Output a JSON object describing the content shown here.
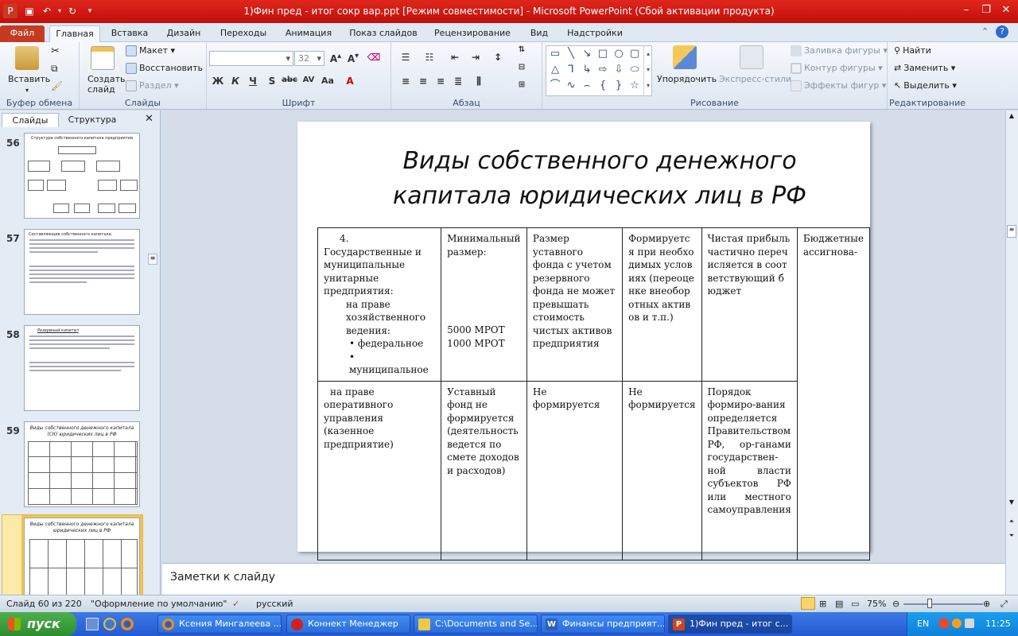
{
  "window": {
    "title": "1)Фин пред - итог сокр вар.ppt [Режим совместимости]  -  Microsoft PowerPoint (Сбой активации продукта)"
  },
  "tabs": [
    "Файл",
    "Главная",
    "Вставка",
    "Дизайн",
    "Переходы",
    "Анимация",
    "Показ слайдов",
    "Рецензирование",
    "Вид",
    "Надстройки"
  ],
  "ribbon": {
    "clipboard": {
      "paste": "Вставить",
      "group": "Буфер обмена"
    },
    "slides": {
      "create": "Создать слайд",
      "layout": "Макет",
      "reset": "Восстановить",
      "section": "Раздел",
      "group": "Слайды"
    },
    "font": {
      "size": "32",
      "group": "Шрифт"
    },
    "paragraph": {
      "group": "Абзац"
    },
    "drawing": {
      "arrange": "Упорядочить",
      "quick_styles": "Экспресс-стили",
      "fill": "Заливка фигуры",
      "outline": "Контур фигуры",
      "effects": "Эффекты фигур",
      "group": "Рисование"
    },
    "editing": {
      "find": "Найти",
      "replace": "Заменить",
      "select": "Выделить",
      "group": "Редактирование"
    }
  },
  "panel": {
    "tab_slides": "Слайды",
    "tab_outline": "Структура"
  },
  "thumbnails": [
    {
      "num": "56",
      "title": "Структура собственного капитала предприятия"
    },
    {
      "num": "57",
      "title": "Составляющие собственного капитала:"
    },
    {
      "num": "58",
      "title": "Резервный капитал"
    },
    {
      "num": "59",
      "title": "Виды собственного денежного капитала (СК) юридических лиц в РФ"
    },
    {
      "num": "60",
      "title": "Виды собственного денежного капитала юридических лиц в РФ"
    }
  ],
  "slide": {
    "title_line1": "Виды собственного денежного",
    "title_line2": "капитала юридических лиц в РФ",
    "table": {
      "r1": {
        "c1_head": "4. Государственные и муниципальные унитарные предприятия:",
        "c1_sub": "на праве хозяйственного ведения:",
        "c1_b1": "• федеральное",
        "c1_b2": "• муниципальное",
        "c2_head": "Минимальный размер:",
        "c2_v1": "5000 МРОТ",
        "c2_v2": "1000 МРОТ",
        "c3": "Размер уставного фонда с учетом резервного фонда не может превышать стоимость чистых активов предприятия",
        "c4": "Формируется при необходимых условиях (переоценке внеоборотных активов и т.п.)",
        "c5": "Чистая прибыль частично перечисляется в соответствующий бюджет",
        "c6": "Бюджетные ассигнова-"
      },
      "r2": {
        "c1": "на праве оперативного управления (казенное предприятие)",
        "c2": "Уставный фонд не формируется (деятельность ведется по смете доходов и расходов)",
        "c3": "Не формируется",
        "c4": "Не формируется",
        "c5": "Порядок формиро-вания определяется Правительством РФ, ор-ганами государствен-ной власти субъектов РФ или местного самоуправления"
      }
    }
  },
  "notes": {
    "placeholder": "Заметки к слайду"
  },
  "status": {
    "slide": "Слайд 60 из 220",
    "theme": "\"Оформление по умолчанию\"",
    "lang": "русский",
    "zoom": "75%"
  },
  "taskbar": {
    "start": "пуск",
    "items": [
      "Ксения Мингалеева ...",
      "Коннект Менеджер",
      "C:\\Documents and Se...",
      "Финансы предприят...",
      "1)Фин пред - итог с..."
    ],
    "lang": "EN",
    "time": "11:25"
  },
  "colors": {
    "title_bar": "#d01a12",
    "file_tab": "#c53b1f",
    "task_bar": "#2d62d8"
  }
}
